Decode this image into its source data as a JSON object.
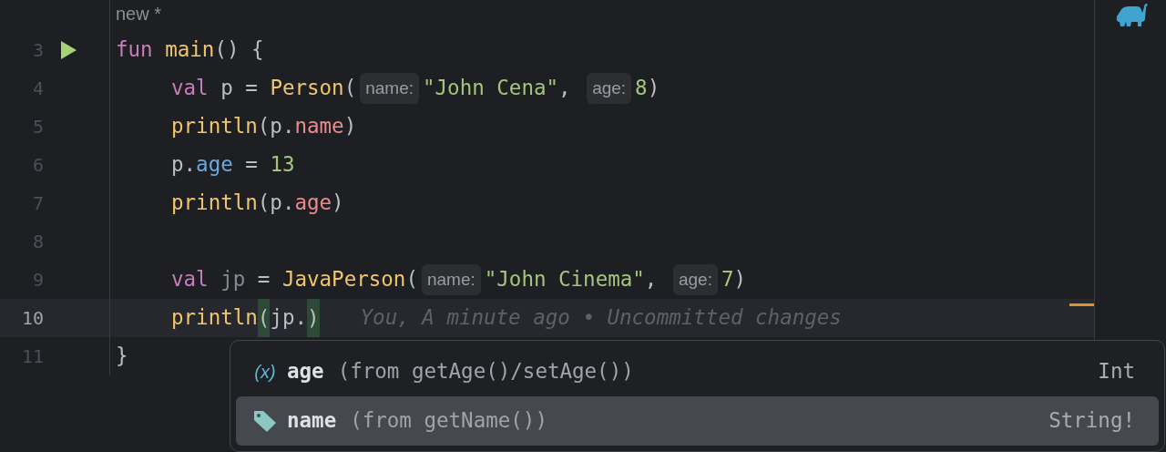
{
  "file_status": "new *",
  "lines": [
    {
      "number": "3",
      "current": false,
      "runnable": true,
      "indented": false,
      "changed": false,
      "tokens": [
        {
          "kind": "keyword",
          "text": "fun "
        },
        {
          "kind": "function",
          "text": "main"
        },
        {
          "kind": "plain",
          "text": "() {"
        }
      ]
    },
    {
      "number": "4",
      "current": false,
      "runnable": false,
      "indented": true,
      "changed": false,
      "tokens": [
        {
          "kind": "keyword",
          "text": "val"
        },
        {
          "kind": "plain",
          "text": " p = "
        },
        {
          "kind": "function",
          "text": "Person"
        },
        {
          "kind": "plain",
          "text": "("
        },
        {
          "kind": "hint",
          "text": "name:"
        },
        {
          "kind": "string",
          "text": "\"John Cena\""
        },
        {
          "kind": "plain",
          "text": ", "
        },
        {
          "kind": "hint",
          "text": "age:"
        },
        {
          "kind": "number",
          "text": "8"
        },
        {
          "kind": "plain",
          "text": ")"
        }
      ]
    },
    {
      "number": "5",
      "current": false,
      "runnable": false,
      "indented": true,
      "changed": false,
      "tokens": [
        {
          "kind": "function",
          "text": "println"
        },
        {
          "kind": "plain",
          "text": "(p."
        },
        {
          "kind": "property",
          "text": "name"
        },
        {
          "kind": "plain",
          "text": ")"
        }
      ]
    },
    {
      "number": "6",
      "current": false,
      "runnable": false,
      "indented": true,
      "changed": false,
      "tokens": [
        {
          "kind": "plain",
          "text": "p."
        },
        {
          "kind": "setter",
          "text": "age"
        },
        {
          "kind": "plain",
          "text": " = "
        },
        {
          "kind": "number",
          "text": "13"
        }
      ]
    },
    {
      "number": "7",
      "current": false,
      "runnable": false,
      "indented": true,
      "changed": false,
      "tokens": [
        {
          "kind": "function",
          "text": "println"
        },
        {
          "kind": "plain",
          "text": "(p."
        },
        {
          "kind": "property",
          "text": "age"
        },
        {
          "kind": "plain",
          "text": ")"
        }
      ]
    },
    {
      "number": "8",
      "current": false,
      "runnable": false,
      "changed": false
    },
    {
      "number": "9",
      "current": false,
      "runnable": false,
      "indented": true,
      "changed": false,
      "tokens": [
        {
          "kind": "keyword",
          "text": "val "
        },
        {
          "kind": "muted",
          "text": "jp"
        },
        {
          "kind": "plain",
          "text": " = "
        },
        {
          "kind": "function",
          "text": "JavaPerson"
        },
        {
          "kind": "plain",
          "text": "("
        },
        {
          "kind": "hint",
          "text": "name:"
        },
        {
          "kind": "string",
          "text": "\"John Cinema\""
        },
        {
          "kind": "plain",
          "text": ", "
        },
        {
          "kind": "hint",
          "text": "age:"
        },
        {
          "kind": "number",
          "text": "7"
        },
        {
          "kind": "plain",
          "text": ")"
        }
      ]
    },
    {
      "number": "10",
      "current": true,
      "runnable": false,
      "indented": true,
      "changed": true,
      "tokens": [
        {
          "kind": "function",
          "text": "println"
        },
        {
          "kind": "matched-bracket",
          "text": "("
        },
        {
          "kind": "plain",
          "text": "jp."
        },
        {
          "kind": "matched-bracket",
          "text": ")"
        },
        {
          "kind": "blame",
          "text": "You, A minute ago • Uncommitted changes"
        }
      ]
    },
    {
      "number": "11",
      "current": false,
      "runnable": false,
      "indented": false,
      "tokens": [
        {
          "kind": "plain",
          "text": "}"
        }
      ]
    }
  ],
  "completion": [
    {
      "kind": "variable",
      "icon_text": "(x)",
      "name": "age",
      "detail": "(from getAge()/setAge())",
      "type": "Int",
      "selected": false
    },
    {
      "kind": "property",
      "name": "name",
      "detail": "(from getName())",
      "type": "String!",
      "selected": true
    }
  ]
}
